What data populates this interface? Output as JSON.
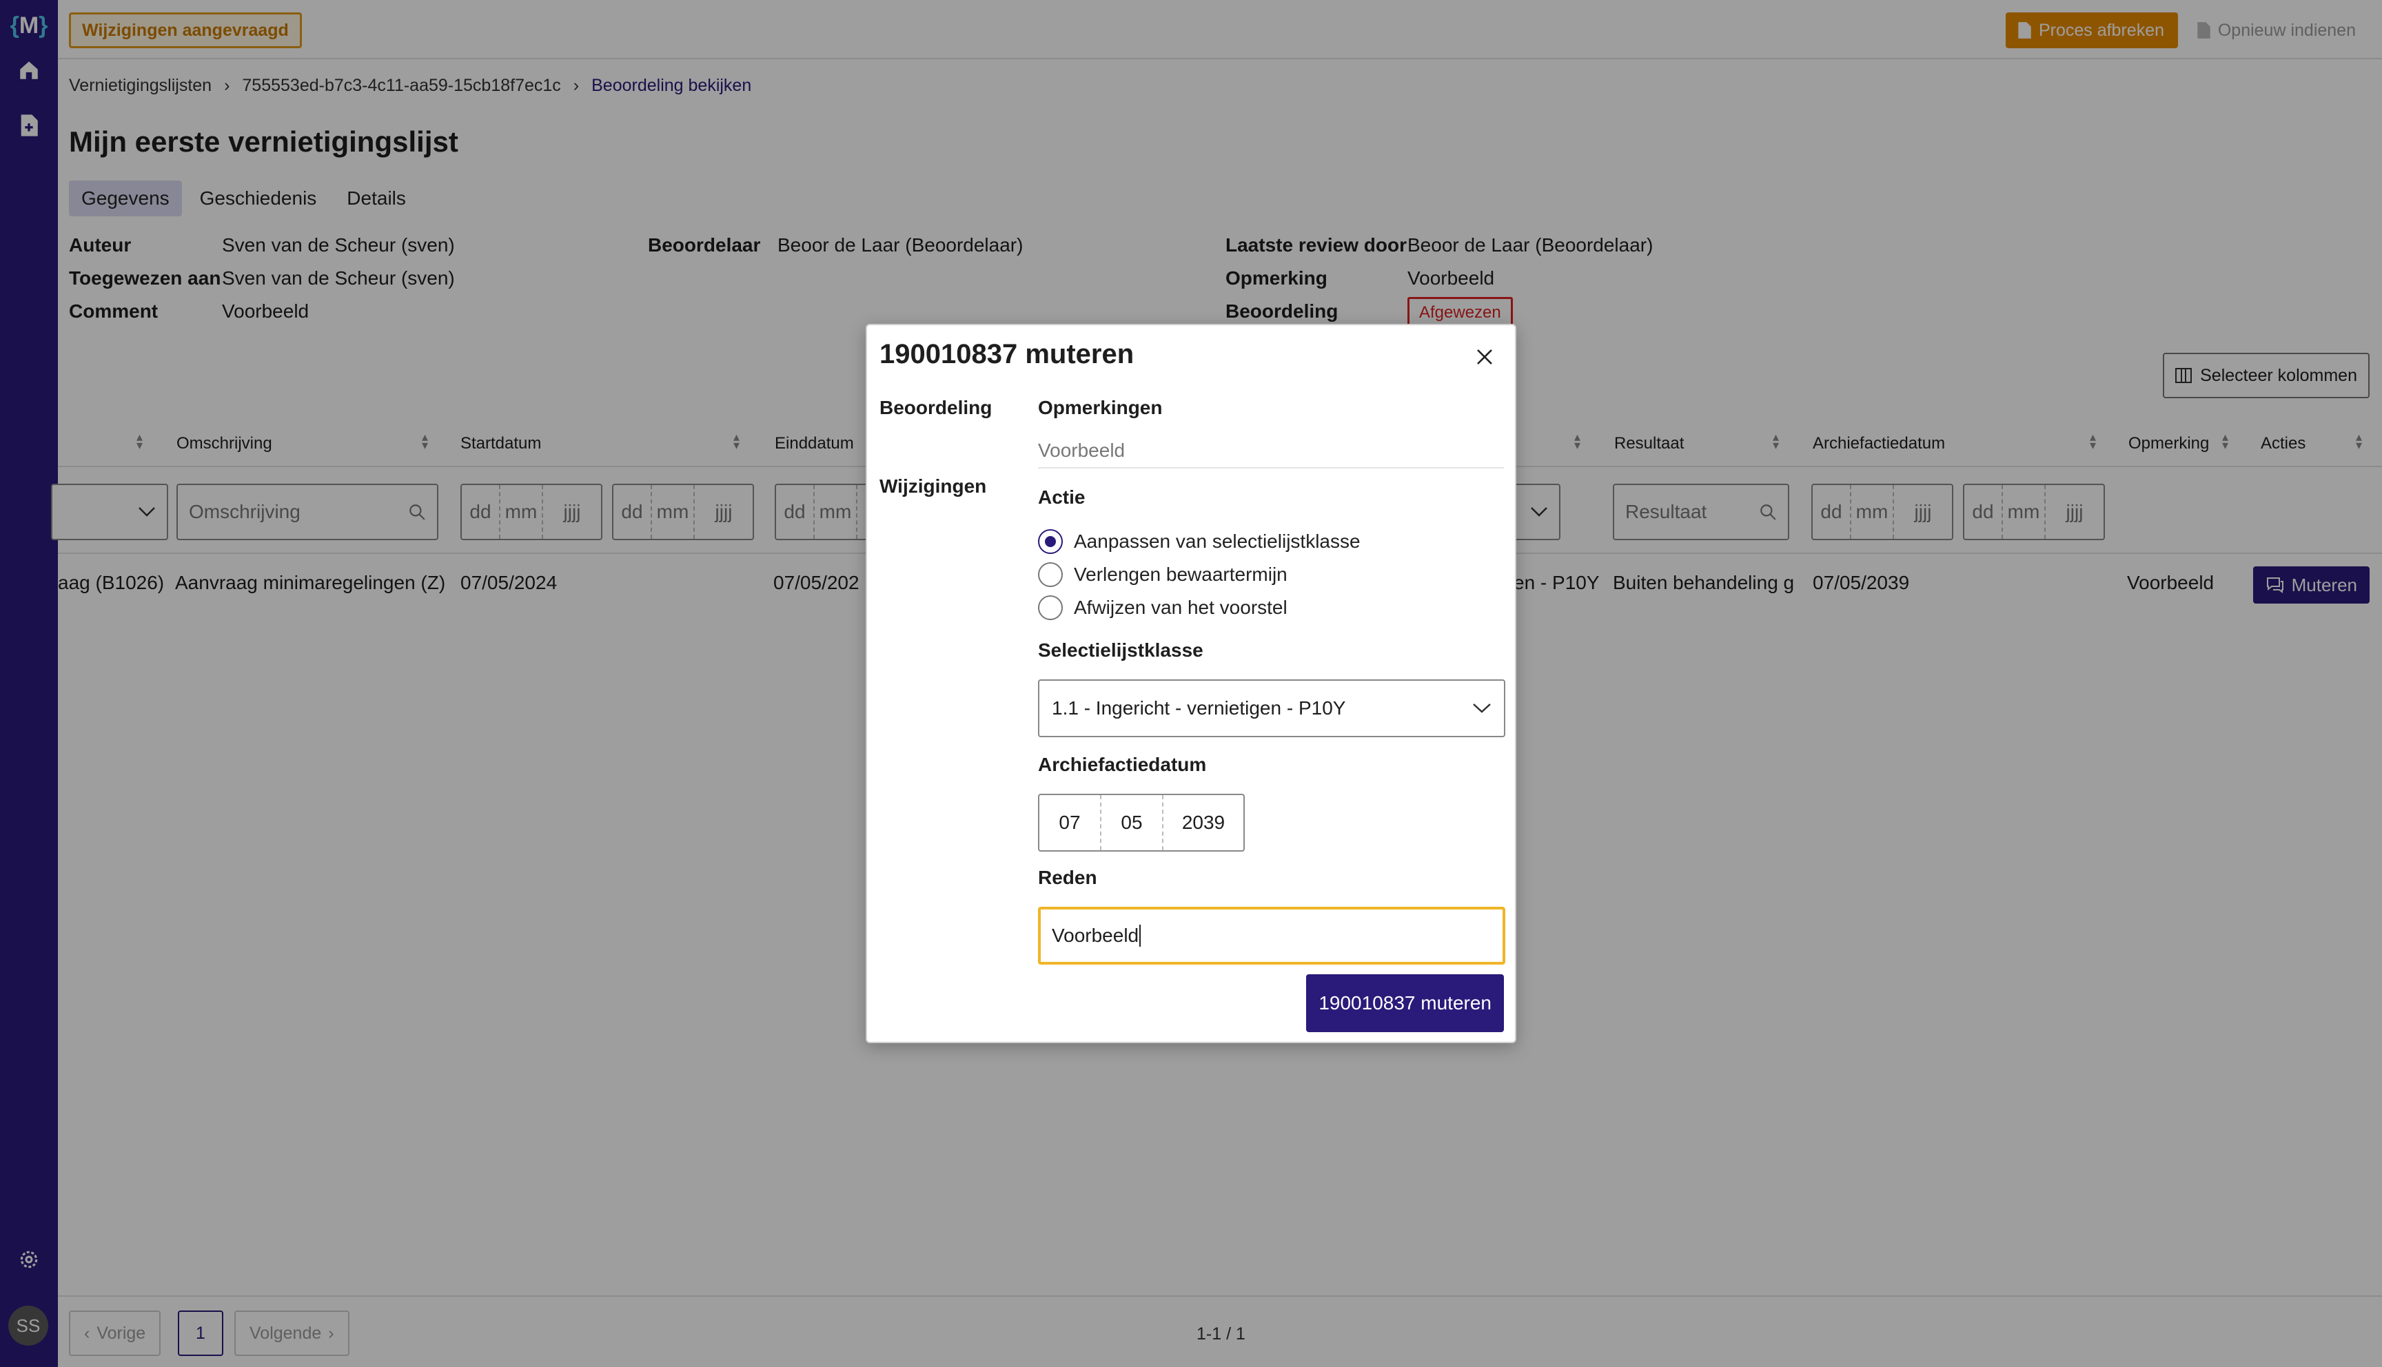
{
  "app": {
    "logo_text": "M"
  },
  "topbar": {
    "status_badge": "Wijzigingen aangevraagd",
    "abort_label": "Proces afbreken",
    "resubmit_label": "Opnieuw indienen"
  },
  "breadcrumb": {
    "items": [
      "Vernietigingslijsten",
      "755553ed-b7c3-4c11-aa59-15cb18f7ec1c",
      "Beoordeling bekijken"
    ]
  },
  "page": {
    "title": "Mijn eerste vernietigingslijst"
  },
  "tabs": [
    {
      "label": "Gegevens",
      "active": true
    },
    {
      "label": "Geschiedenis",
      "active": false
    },
    {
      "label": "Details",
      "active": false
    }
  ],
  "meta": {
    "col1": [
      {
        "key": "Auteur",
        "value": "Sven van de Scheur (sven)"
      },
      {
        "key": "Toegewezen aan",
        "value": "Sven van de Scheur (sven)"
      },
      {
        "key": "Comment",
        "value": "Voorbeeld"
      }
    ],
    "col2": [
      {
        "key": "Beoordelaar",
        "value": "Beoor de Laar (Beoordelaar)"
      }
    ],
    "col3": [
      {
        "key": "Laatste review door",
        "value": "Beoor de Laar (Beoordelaar)"
      },
      {
        "key": "Opmerking",
        "value": "Voorbeeld"
      },
      {
        "key": "Beoordeling",
        "value": "Afgewezen"
      }
    ]
  },
  "select_columns_label": "Selecteer kolommen",
  "table": {
    "headers": {
      "omschrijving": "Omschrijving",
      "startdatum": "Startdatum",
      "einddatum": "Einddatum",
      "resultaat": "Resultaat",
      "archiefactiedatum": "Archiefactiedatum",
      "opmerking": "Opmerking",
      "acties": "Acties"
    },
    "filters": {
      "omschrijving_placeholder": "Omschrijving",
      "resultaat_placeholder": "Resultaat",
      "dd": "dd",
      "mm": "mm",
      "jjjj": "jjjj"
    },
    "row": {
      "zaaktype": "aag (B1026)",
      "omschrijving": "Aanvraag minimaregelingen (Z)",
      "startdatum": "07/05/2024",
      "einddatum": "07/05/202",
      "selectielijst": "en - P10Y",
      "resultaat": "Buiten behandeling g",
      "archiefactiedatum": "07/05/2039",
      "opmerking": "Voorbeeld",
      "action_label": "Muteren"
    }
  },
  "pager": {
    "prev_label": "Vorige",
    "current_page": "1",
    "next_label": "Volgende",
    "count": "1-1 / 1"
  },
  "user": {
    "initials": "SS"
  },
  "modal": {
    "title": "190010837 muteren",
    "section_beoordeling": "Beoordeling",
    "opmerkingen_label": "Opmerkingen",
    "opmerkingen_value": "Voorbeeld",
    "section_wijzigingen": "Wijzigingen",
    "actie_label": "Actie",
    "options": [
      {
        "label": "Aanpassen van selectielijstklasse",
        "checked": true
      },
      {
        "label": "Verlengen bewaartermijn",
        "checked": false
      },
      {
        "label": "Afwijzen van het voorstel",
        "checked": false
      }
    ],
    "selectielijst_label": "Selectielijstklasse",
    "selectielijst_value": "1.1 - Ingericht - vernietigen - P10Y",
    "archief_label": "Archiefactiedatum",
    "archief_day": "07",
    "archief_month": "05",
    "archief_year": "2039",
    "reden_label": "Reden",
    "reden_value": "Voorbeeld",
    "submit_label": "190010837 muteren"
  },
  "colors": {
    "brand": "#2a1a7a",
    "warning": "#e58a00",
    "danger": "#dd2222",
    "focus": "#f0b528"
  }
}
